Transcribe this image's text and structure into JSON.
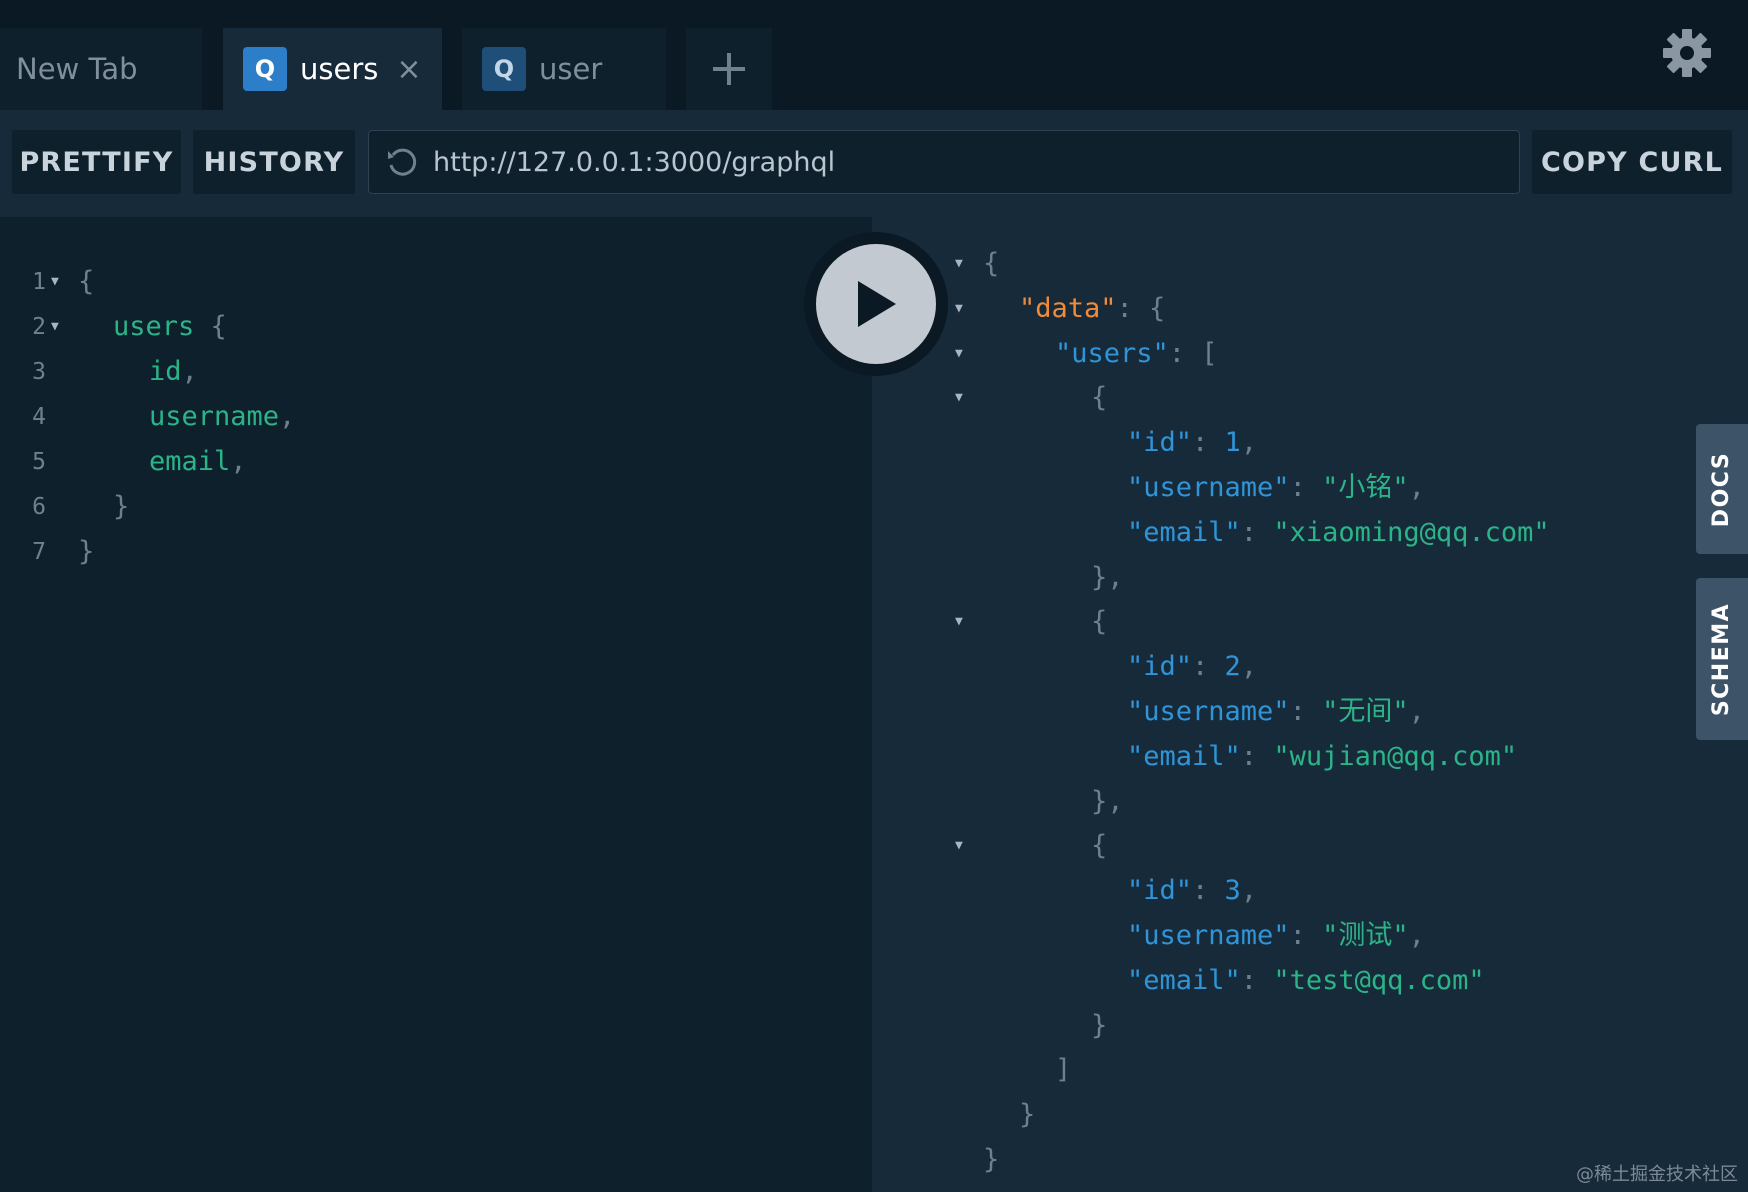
{
  "tabs": [
    {
      "label": "New Tab",
      "badge": ""
    },
    {
      "label": "users",
      "badge": "Q",
      "close": "×"
    },
    {
      "label": "user",
      "badge": "Q"
    }
  ],
  "toolbar": {
    "prettify_label": "PRETTIFY",
    "history_label": "HISTORY",
    "endpoint_url": "http://127.0.0.1:3000/graphql",
    "copy_curl_label": "COPY CURL"
  },
  "editor": {
    "line_numbers": [
      "1",
      "2",
      "3",
      "4",
      "5",
      "6",
      "7"
    ],
    "lines": [
      {
        "open": "{"
      },
      {
        "field": "users",
        "open": " {"
      },
      {
        "field": "id",
        "punc": ","
      },
      {
        "field": "username",
        "punc": ","
      },
      {
        "field": "email",
        "punc": ","
      },
      {
        "close": "}"
      },
      {
        "close": "}"
      }
    ]
  },
  "result": {
    "lines": [
      {
        "p1": "{"
      },
      {
        "k": "\"data\"",
        "p1": ": {"
      },
      {
        "k": "\"users\"",
        "p1": ": ["
      },
      {
        "p1": "{"
      },
      {
        "k": "\"id\"",
        "p1": ": ",
        "n": "1",
        "p2": ","
      },
      {
        "k": "\"username\"",
        "p1": ": ",
        "s": "\"小铭\"",
        "p2": ","
      },
      {
        "k": "\"email\"",
        "p1": ": ",
        "s": "\"xiaoming@qq.com\""
      },
      {
        "p1": "},"
      },
      {
        "p1": "{"
      },
      {
        "k": "\"id\"",
        "p1": ": ",
        "n": "2",
        "p2": ","
      },
      {
        "k": "\"username\"",
        "p1": ": ",
        "s": "\"无间\"",
        "p2": ","
      },
      {
        "k": "\"email\"",
        "p1": ": ",
        "s": "\"wujian@qq.com\""
      },
      {
        "p1": "},"
      },
      {
        "p1": "{"
      },
      {
        "k": "\"id\"",
        "p1": ": ",
        "n": "3",
        "p2": ","
      },
      {
        "k": "\"username\"",
        "p1": ": ",
        "s": "\"测试\"",
        "p2": ","
      },
      {
        "k": "\"email\"",
        "p1": ": ",
        "s": "\"test@qq.com\""
      },
      {
        "p1": "}"
      },
      {
        "p1": "]"
      },
      {
        "p1": "}"
      },
      {
        "p1": "}"
      }
    ]
  },
  "side_tabs": {
    "docs": "DOCS",
    "schema": "SCHEMA"
  },
  "watermark": "@稀土掘金技术社区",
  "colors": {
    "background": "#172a3a",
    "editor_bg": "#0f202d",
    "topbar_bg": "#0b1924",
    "field_green": "#2bb487",
    "key_blue": "#2f95d8",
    "key_orange": "#f08b3a",
    "badge_blue": "#2b7ec7"
  },
  "icons": [
    "settings-gear-icon",
    "refresh-icon",
    "plus-icon",
    "play-icon",
    "close-icon"
  ]
}
